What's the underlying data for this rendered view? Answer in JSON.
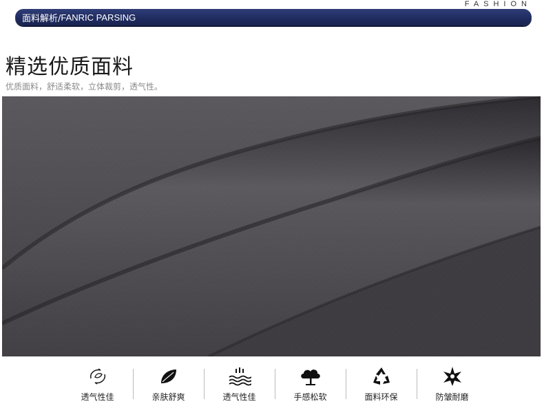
{
  "header": {
    "fashion": "FASHION",
    "banner_cn": "面料解析/",
    "banner_en": "FANRIC PARSING"
  },
  "section": {
    "title": "精选优质面料",
    "subtitle": "优质面料，舒适柔软，立体裁剪，透气性。"
  },
  "features": [
    {
      "label": "透气性佳",
      "icon": "leaves-swirl-icon"
    },
    {
      "label": "亲肤舒爽",
      "icon": "leaf-icon"
    },
    {
      "label": "透气性佳",
      "icon": "water-wave-icon"
    },
    {
      "label": "手感松软",
      "icon": "cloud-tree-icon"
    },
    {
      "label": "面料环保",
      "icon": "recycle-icon"
    },
    {
      "label": "防皱耐磨",
      "icon": "star-burst-icon"
    }
  ],
  "colors": {
    "banner": "#24306a",
    "fabric": "#48464a",
    "text": "#222222"
  }
}
